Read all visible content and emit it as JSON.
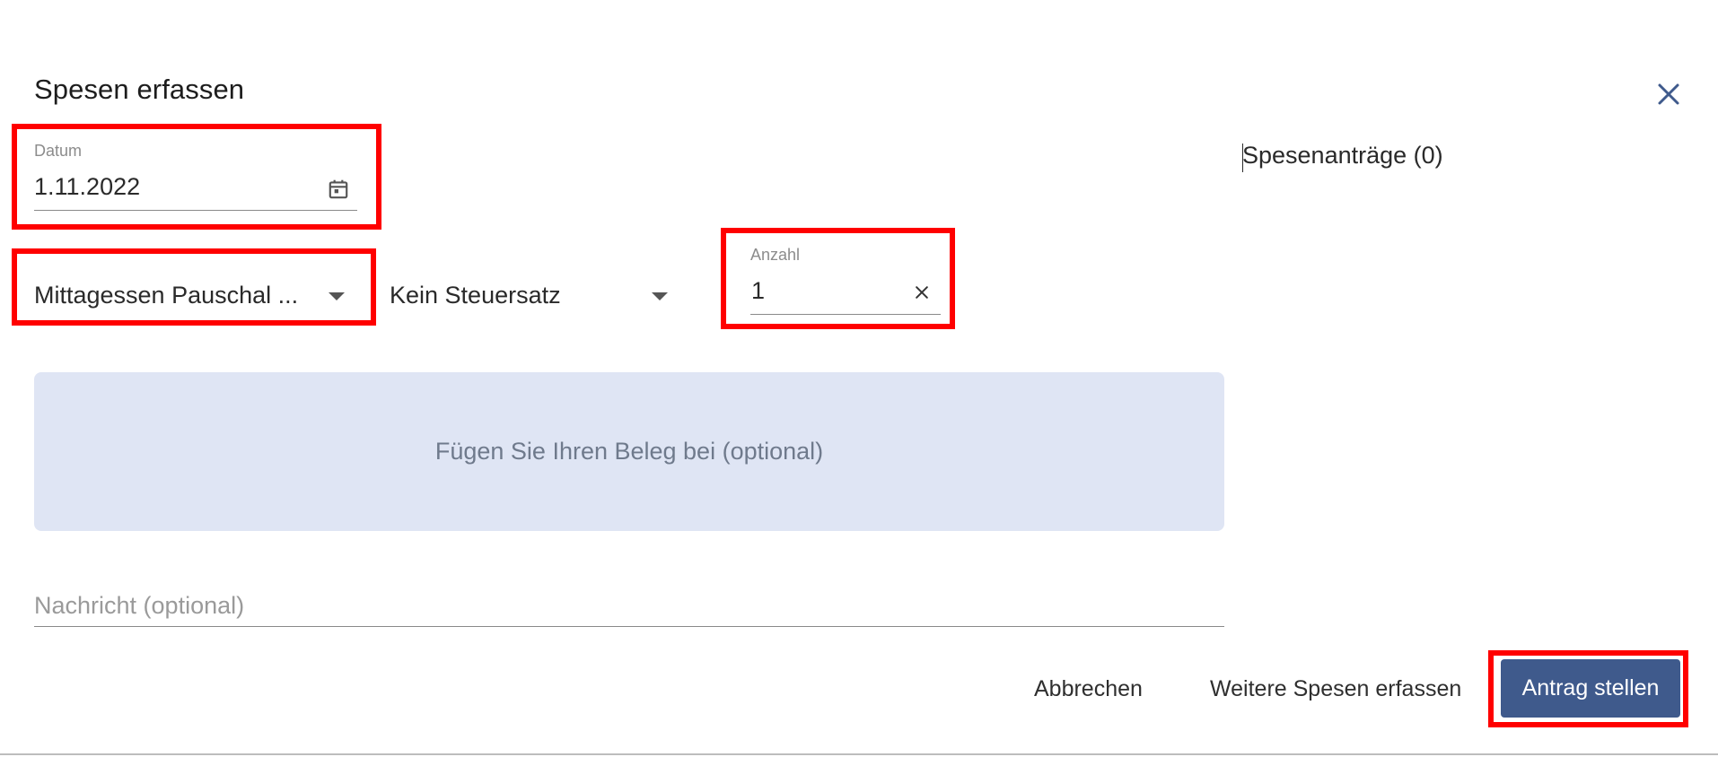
{
  "dialog": {
    "title": "Spesen erfassen"
  },
  "date_field": {
    "label": "Datum",
    "value": "1.11.2022",
    "icon": "calendar-icon"
  },
  "expense_type_select": {
    "value": "Mittagessen Pauschal ..."
  },
  "tax_select": {
    "value": "Kein Steuersatz"
  },
  "quantity_field": {
    "label": "Anzahl",
    "value": "1",
    "icon": "clear-icon"
  },
  "upload": {
    "label": "Fügen Sie Ihren Beleg bei (optional)"
  },
  "message_field": {
    "placeholder": "Nachricht (optional)",
    "value": ""
  },
  "side_panel": {
    "title": "Spesenanträge (0)"
  },
  "actions": {
    "cancel_label": "Abbrechen",
    "add_more_label": "Weitere Spesen erfassen",
    "submit_label": "Antrag stellen"
  },
  "colors": {
    "primary": "#3f5a8c",
    "upload_bg": "#dfe5f4",
    "highlight": "#ff0000",
    "close_icon": "#3f5a8c"
  }
}
